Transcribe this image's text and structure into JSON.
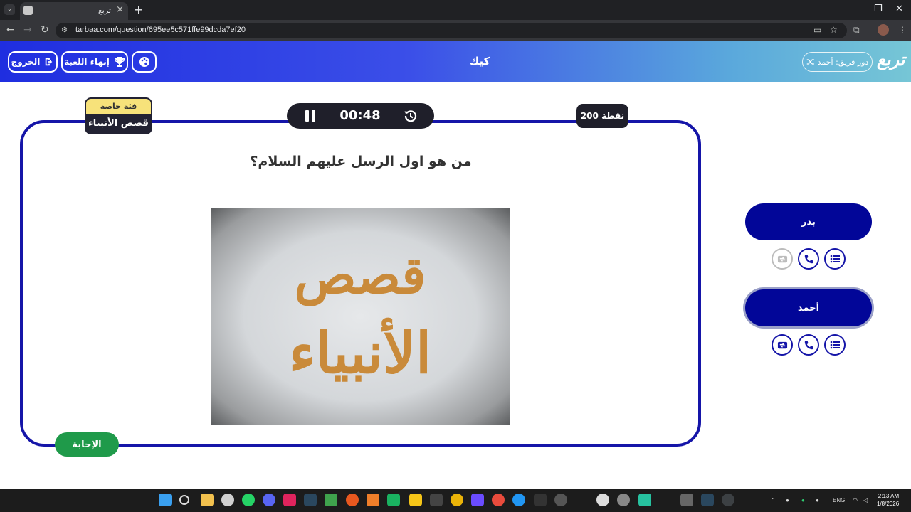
{
  "browser": {
    "tab_title": "تربع",
    "url": "tarbaa.com/question/695ee5c571ffe99dcda7ef20"
  },
  "header": {
    "logo": "تربع",
    "turn_label": "دور فريق: أحمد",
    "category_title": "كيك",
    "end_game_label": "إنهاء اللعبة",
    "exit_label": "الخروج"
  },
  "question": {
    "category_tag": "فئة خاصة",
    "category_name": "قصص الأنبياء",
    "timer": "00:48",
    "points": "200 نقطة",
    "text": "من هو اول الرسل عليهم السلام؟",
    "image_text_line1": "قصص",
    "image_text_line2": "الأنبياء",
    "answer_button": "الإجابة"
  },
  "teams": [
    {
      "name": "بدر",
      "active": false,
      "aids": [
        "list-icon",
        "phone-icon",
        "swap-icon"
      ],
      "swap_used": true
    },
    {
      "name": "أحمد",
      "active": true,
      "aids": [
        "list-icon",
        "phone-icon",
        "swap-icon"
      ],
      "swap_used": false
    }
  ],
  "system": {
    "time": "2:13 AM",
    "date": "1/8/2026",
    "lang": "ENG"
  },
  "colors": {
    "board_border": "#1515a8",
    "team_fill": "#020698",
    "answer_green": "#1f9a4a",
    "category_yellow": "#f7e27a"
  }
}
